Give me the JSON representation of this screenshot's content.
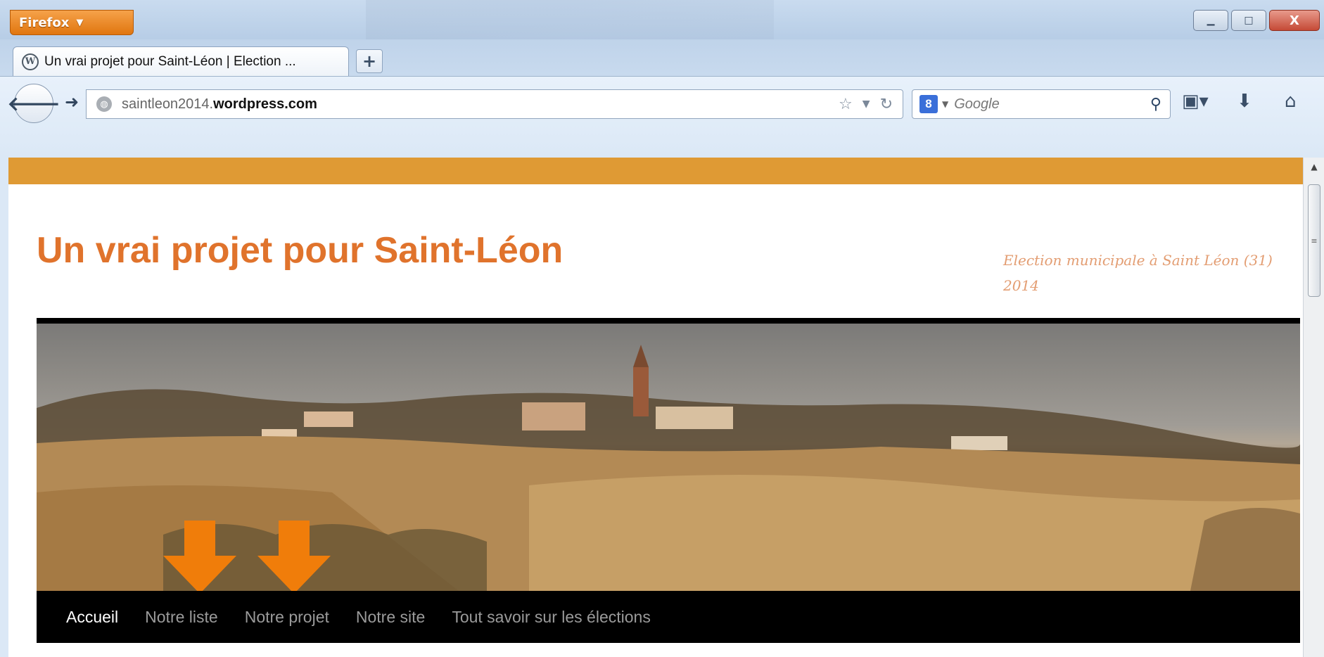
{
  "browser": {
    "menu_button": "Firefox",
    "tab_title": "Un vrai projet pour Saint-Léon | Election ...",
    "new_tab": "+",
    "url_domain": "saintleon2014.",
    "url_host": "wordpress.com",
    "search_engine_letter": "8",
    "search_placeholder": "Google",
    "window_controls": {
      "minimize": "▁",
      "maximize": "□",
      "close": "X"
    }
  },
  "site": {
    "title": "Un vrai projet pour Saint-Léon",
    "description": "Election municipale à Saint Léon (31) 2014",
    "menu": [
      {
        "label": "Accueil",
        "active": true
      },
      {
        "label": "Notre liste",
        "active": false
      },
      {
        "label": "Notre projet",
        "active": false
      },
      {
        "label": "Notre site",
        "active": false
      },
      {
        "label": "Tout savoir sur les élections",
        "active": false
      }
    ]
  },
  "colors": {
    "accent_orange": "#df9a34",
    "title_orange": "#e0732c",
    "arrow_orange": "#f07d0a",
    "menu_bg": "#000000"
  },
  "icons": [
    "wordpress-icon",
    "back-arrow-icon",
    "forward-arrow-icon",
    "globe-icon",
    "star-icon",
    "dropdown-icon",
    "reload-icon",
    "google-icon",
    "search-icon",
    "bookmarks-icon",
    "download-icon",
    "home-icon"
  ]
}
